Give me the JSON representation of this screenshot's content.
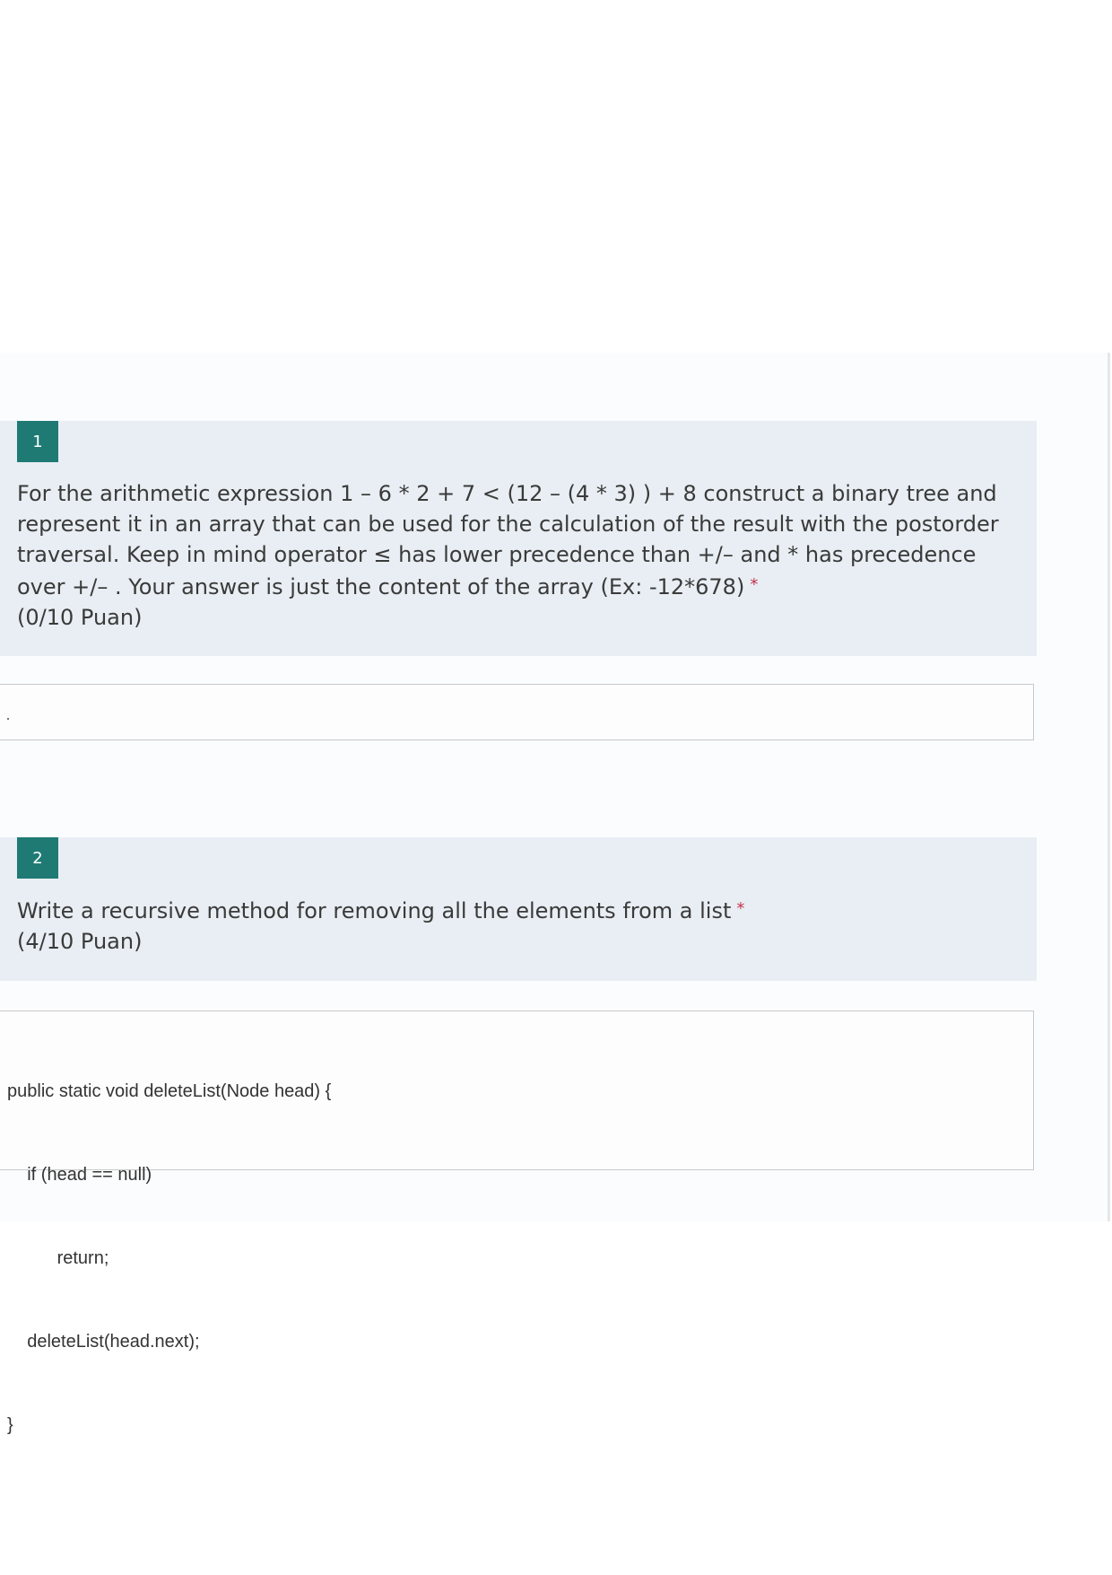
{
  "questions": [
    {
      "number": "1",
      "text": "For the arithmetic expression 1 – 6 * 2 + 7 < (12 – (4 * 3) ) + 8 construct a binary tree and represent it in an array that can be used for the calculation of the result with the postorder traversal.  Keep in mind operator ≤ has lower precedence than +/– and * has precedence over +/– . Your answer is just the content of the array (Ex: -12*678)",
      "required_mark": "*",
      "points": "(0/10 Puan)",
      "answer": ""
    },
    {
      "number": "2",
      "text": "Write a recursive method for removing all the elements from a list",
      "required_mark": "*",
      "points": "(4/10 Puan)",
      "answer_lines": [
        "public static void deleteList(Node head) {",
        "    if (head == null)",
        "          return;",
        "    deleteList(head.next);",
        "}"
      ]
    }
  ],
  "colors": {
    "question_background": "#e8eef3",
    "number_badge": "#1f7a74",
    "required_star": "#c4314b"
  }
}
